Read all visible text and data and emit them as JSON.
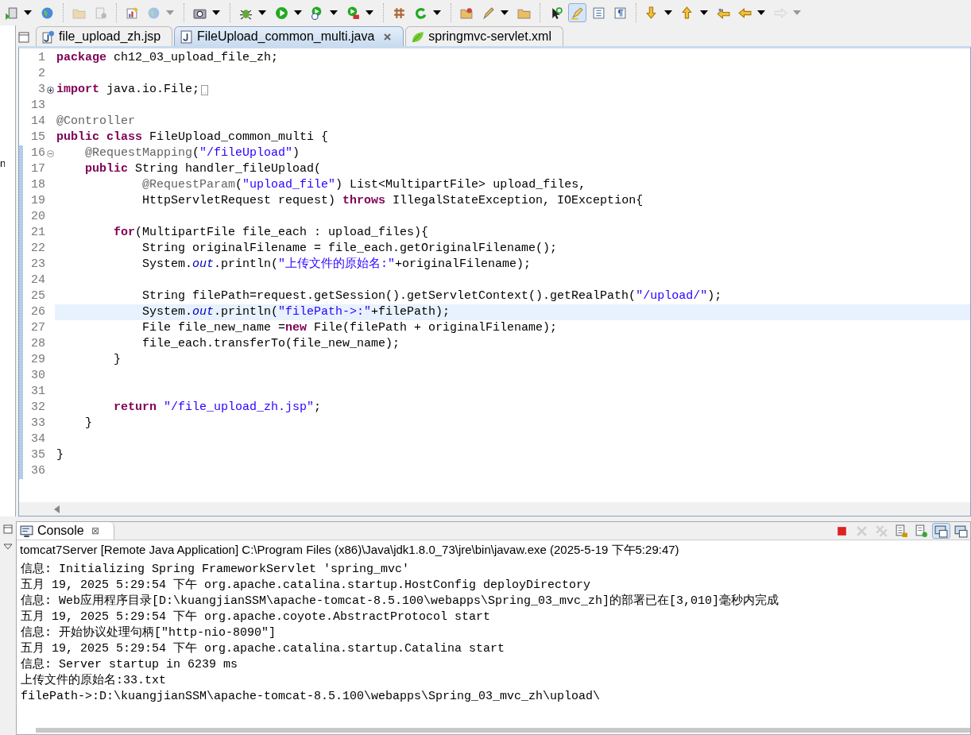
{
  "toolbar": [
    [
      {
        "kind": "server",
        "dropdown": true,
        "disabled": false,
        "selected": false
      },
      {
        "kind": "globe",
        "dropdown": false,
        "disabled": false,
        "selected": false
      }
    ],
    [
      {
        "kind": "folder",
        "dropdown": false,
        "disabled": true,
        "selected": false
      },
      {
        "kind": "document",
        "dropdown": false,
        "disabled": true,
        "selected": false
      }
    ],
    [
      {
        "kind": "chart",
        "dropdown": false,
        "disabled": false,
        "selected": false
      },
      {
        "kind": "globe",
        "dropdown": true,
        "disabled": true,
        "selected": false
      }
    ],
    [
      {
        "kind": "camera",
        "dropdown": true,
        "disabled": false,
        "selected": false
      }
    ],
    [
      {
        "kind": "bug",
        "dropdown": true,
        "disabled": false,
        "selected": false
      },
      {
        "kind": "run",
        "dropdown": true,
        "disabled": false,
        "selected": false
      },
      {
        "kind": "runclock",
        "dropdown": true,
        "disabled": false,
        "selected": false
      },
      {
        "kind": "runcase",
        "dropdown": true,
        "disabled": false,
        "selected": false
      }
    ],
    [
      {
        "kind": "grid",
        "dropdown": false,
        "disabled": false,
        "selected": false
      },
      {
        "kind": "refresh",
        "dropdown": true,
        "disabled": false,
        "selected": false
      }
    ],
    [
      {
        "kind": "folderopen",
        "dropdown": false,
        "disabled": false,
        "selected": false
      },
      {
        "kind": "pen",
        "dropdown": true,
        "disabled": false,
        "selected": false
      },
      {
        "kind": "folder",
        "dropdown": false,
        "disabled": false,
        "selected": false
      }
    ],
    [
      {
        "kind": "cursor",
        "dropdown": false,
        "disabled": false,
        "selected": false
      },
      {
        "kind": "highlighter",
        "dropdown": false,
        "disabled": false,
        "selected": true
      },
      {
        "kind": "page",
        "dropdown": false,
        "disabled": false,
        "selected": false
      },
      {
        "kind": "pilcrow",
        "dropdown": false,
        "disabled": false,
        "selected": false
      }
    ],
    [
      {
        "kind": "down",
        "dropdown": true,
        "disabled": false,
        "selected": false
      },
      {
        "kind": "up",
        "dropdown": true,
        "disabled": false,
        "selected": false
      },
      {
        "kind": "backstar",
        "dropdown": false,
        "disabled": false,
        "selected": false
      },
      {
        "kind": "back",
        "dropdown": true,
        "disabled": false,
        "selected": false
      },
      {
        "kind": "forward",
        "dropdown": true,
        "disabled": true,
        "selected": false
      }
    ]
  ],
  "left_panel": {
    "fragment": "n"
  },
  "editor_tabs": [
    {
      "label": "file_upload_zh.jsp",
      "kind": "jsp",
      "selected": false
    },
    {
      "label": "FileUpload_common_multi.java",
      "kind": "java",
      "selected": true
    },
    {
      "label": "springmvc-servlet.xml",
      "kind": "leaf",
      "selected": false
    }
  ],
  "code": [
    {
      "number": "1",
      "kind": "line",
      "changed": false,
      "current": false,
      "tokens": [
        {
          "kind": "kw",
          "text": "package"
        },
        {
          "kind": "plain",
          "text": " ch12_03_upload_file_zh;"
        }
      ]
    },
    {
      "number": "2",
      "kind": "line",
      "changed": false,
      "current": false
    },
    {
      "number": "3",
      "kind": "folded",
      "changed": false,
      "current": false,
      "tokens": [
        {
          "kind": "kw",
          "text": "import"
        },
        {
          "kind": "plain",
          "text": " java.io.File;"
        }
      ]
    },
    {
      "number": "13",
      "kind": "line",
      "changed": false,
      "current": false
    },
    {
      "number": "14",
      "kind": "line",
      "changed": false,
      "current": false,
      "tokens": [
        {
          "kind": "ann",
          "text": "@Controller"
        }
      ]
    },
    {
      "number": "15",
      "kind": "line",
      "changed": false,
      "current": false,
      "tokens": [
        {
          "kind": "kw",
          "text": "public class"
        },
        {
          "kind": "plain",
          "text": " FileUpload_common_multi {"
        }
      ]
    },
    {
      "number": "16",
      "kind": "foldable",
      "changed": true,
      "current": false,
      "tokens": [
        {
          "kind": "ann",
          "text": "    @RequestMapping"
        },
        {
          "kind": "plain",
          "text": "("
        },
        {
          "kind": "str",
          "text": "\"/fileUpload\""
        },
        {
          "kind": "plain",
          "text": ")"
        }
      ]
    },
    {
      "number": "17",
      "kind": "line",
      "changed": true,
      "current": false,
      "tokens": [
        {
          "kind": "kw",
          "text": "    public"
        },
        {
          "kind": "plain",
          "text": " String handler_fileUpload("
        }
      ]
    },
    {
      "number": "18",
      "kind": "line",
      "changed": true,
      "current": false,
      "tokens": [
        {
          "kind": "ann",
          "text": "            @RequestParam"
        },
        {
          "kind": "plain",
          "text": "("
        },
        {
          "kind": "str",
          "text": "\"upload_file\""
        },
        {
          "kind": "plain",
          "text": ") List<MultipartFile> upload_files,"
        }
      ]
    },
    {
      "number": "19",
      "kind": "line",
      "changed": true,
      "current": false,
      "tokens": [
        {
          "kind": "plain",
          "text": "            HttpServletRequest request) "
        },
        {
          "kind": "kw",
          "text": "throws"
        },
        {
          "kind": "plain",
          "text": " IllegalStateException, IOException{"
        }
      ]
    },
    {
      "number": "20",
      "kind": "line",
      "changed": true,
      "current": false
    },
    {
      "number": "21",
      "kind": "line",
      "changed": true,
      "current": false,
      "tokens": [
        {
          "kind": "kw",
          "text": "        for"
        },
        {
          "kind": "plain",
          "text": "(MultipartFile file_each : upload_files){"
        }
      ]
    },
    {
      "number": "22",
      "kind": "line",
      "changed": true,
      "current": false,
      "tokens": [
        {
          "kind": "plain",
          "text": "            String originalFilename = file_each.getOriginalFilename();"
        }
      ]
    },
    {
      "number": "23",
      "kind": "line",
      "changed": true,
      "current": false,
      "tokens": [
        {
          "kind": "plain",
          "text": "            System."
        },
        {
          "kind": "field",
          "text": "out"
        },
        {
          "kind": "plain",
          "text": ".println("
        },
        {
          "kind": "str",
          "text": "\"上传文件的原始名:\""
        },
        {
          "kind": "plain",
          "text": "+originalFilename);"
        }
      ]
    },
    {
      "number": "24",
      "kind": "line",
      "changed": true,
      "current": false
    },
    {
      "number": "25",
      "kind": "line",
      "changed": true,
      "current": false,
      "tokens": [
        {
          "kind": "plain",
          "text": "            String filePath=request.getSession().getServletContext().getRealPath("
        },
        {
          "kind": "str",
          "text": "\"/upload/\""
        },
        {
          "kind": "plain",
          "text": ");"
        }
      ]
    },
    {
      "number": "26",
      "kind": "line",
      "changed": true,
      "current": true,
      "tokens": [
        {
          "kind": "plain",
          "text": "            System."
        },
        {
          "kind": "field",
          "text": "out"
        },
        {
          "kind": "plain",
          "text": ".println("
        },
        {
          "kind": "str",
          "text": "\"filePath->:\""
        },
        {
          "kind": "plain",
          "text": "+filePath);"
        }
      ]
    },
    {
      "number": "27",
      "kind": "line",
      "changed": true,
      "current": false,
      "tokens": [
        {
          "kind": "plain",
          "text": "            File file_new_name ="
        },
        {
          "kind": "kw",
          "text": "new"
        },
        {
          "kind": "plain",
          "text": " File(filePath + originalFilename);"
        }
      ]
    },
    {
      "number": "28",
      "kind": "line",
      "changed": true,
      "current": false,
      "tokens": [
        {
          "kind": "plain",
          "text": "            file_each.transferTo(file_new_name);"
        }
      ]
    },
    {
      "number": "29",
      "kind": "line",
      "changed": true,
      "current": false,
      "tokens": [
        {
          "kind": "plain",
          "text": "        }"
        }
      ]
    },
    {
      "number": "30",
      "kind": "line",
      "changed": true,
      "current": false
    },
    {
      "number": "31",
      "kind": "line",
      "changed": true,
      "current": false
    },
    {
      "number": "32",
      "kind": "line",
      "changed": true,
      "current": false,
      "tokens": [
        {
          "kind": "kw",
          "text": "        return"
        },
        {
          "kind": "str",
          "text": " \"/file_upload_zh.jsp\""
        },
        {
          "kind": "plain",
          "text": ";"
        }
      ]
    },
    {
      "number": "33",
      "kind": "line",
      "changed": true,
      "current": false,
      "tokens": [
        {
          "kind": "plain",
          "text": "    }"
        }
      ]
    },
    {
      "number": "34",
      "kind": "line",
      "changed": true,
      "current": false
    },
    {
      "number": "35",
      "kind": "line",
      "changed": true,
      "current": false,
      "tokens": [
        {
          "kind": "plain",
          "text": "}"
        }
      ]
    },
    {
      "number": "36",
      "kind": "line",
      "changed": true,
      "current": false
    }
  ],
  "console": {
    "tab": {
      "label": "Console",
      "close": "⊠"
    },
    "tools": [
      {
        "kind": "stop",
        "disabled": false,
        "selected": false
      },
      {
        "kind": "remove",
        "disabled": true,
        "selected": false
      },
      {
        "kind": "removeall",
        "disabled": true,
        "selected": false
      },
      {
        "kind": "doclock",
        "disabled": false,
        "selected": false
      },
      {
        "kind": "docpin",
        "disabled": false,
        "selected": false
      },
      {
        "kind": "monitor",
        "disabled": false,
        "selected": true
      },
      {
        "kind": "monitor",
        "disabled": false,
        "selected": false
      }
    ],
    "description": "tomcat7Server [Remote Java Application] C:\\Program Files (x86)\\Java\\jdk1.8.0_73\\jre\\bin\\javaw.exe (2025-5-19 下午5:29:47)",
    "lines": [
      "信息: Initializing Spring FrameworkServlet 'spring_mvc'",
      "五月 19, 2025 5:29:54 下午 org.apache.catalina.startup.HostConfig deployDirectory",
      "信息: Web应用程序目录[D:\\kuangjianSSM\\apache-tomcat-8.5.100\\webapps\\Spring_03_mvc_zh]的部署已在[3,010]毫秒内完成",
      "五月 19, 2025 5:29:54 下午 org.apache.coyote.AbstractProtocol start",
      "信息: 开始协议处理句柄[\"http-nio-8090\"]",
      "五月 19, 2025 5:29:54 下午 org.apache.catalina.startup.Catalina start",
      "信息: Server startup in 6239 ms",
      "上传文件的原始名:33.txt",
      "filePath->:D:\\kuangjianSSM\\apache-tomcat-8.5.100\\webapps\\Spring_03_mvc_zh\\upload\\"
    ]
  }
}
